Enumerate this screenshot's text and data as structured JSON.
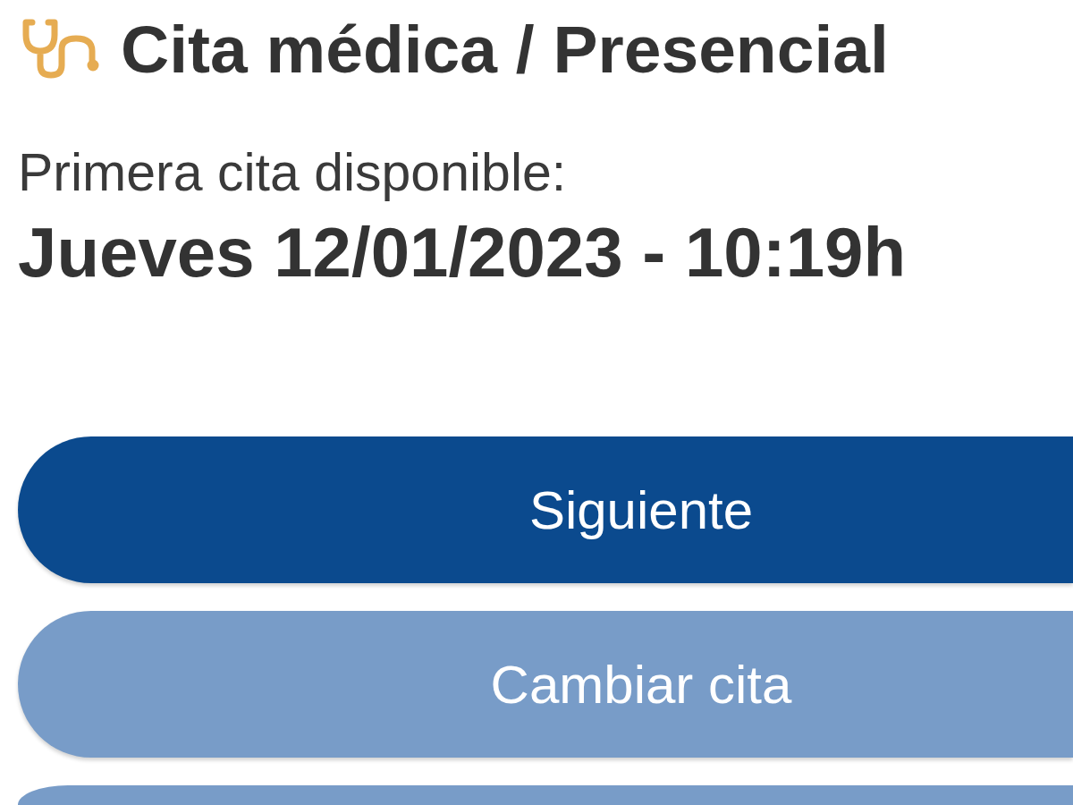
{
  "header": {
    "title": "Cita médica / Presencial"
  },
  "availability": {
    "label": "Primera cita disponible:",
    "date_time": "Jueves 12/01/2023 - 10:19h"
  },
  "buttons": [
    {
      "label": "Siguiente",
      "kind": "primary"
    },
    {
      "label": "Cambiar cita",
      "kind": "secondary"
    },
    {
      "kind": "secondary"
    }
  ]
}
